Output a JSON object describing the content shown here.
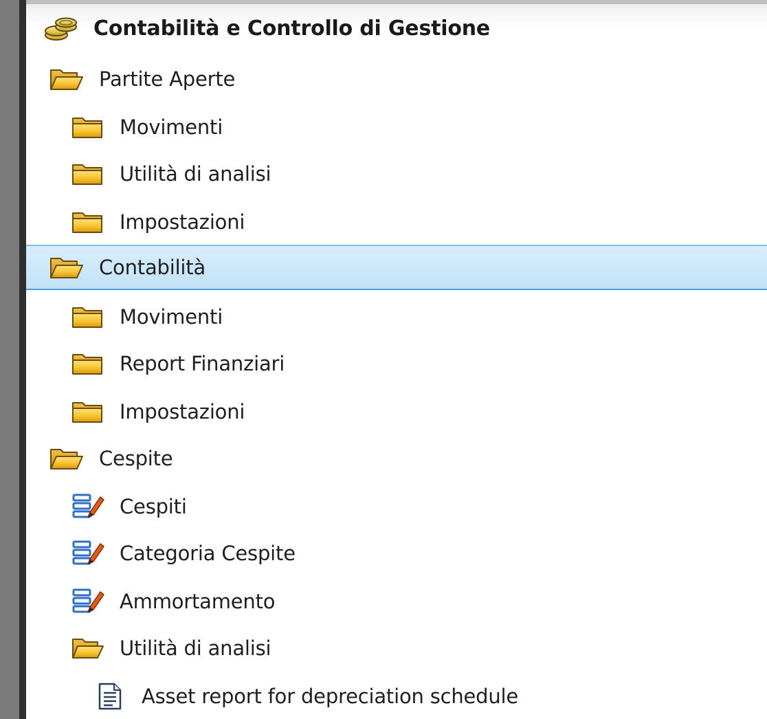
{
  "tree": {
    "root": {
      "label": "Contabilità e Controllo di Gestione",
      "icon": "coins-icon"
    },
    "items": [
      {
        "label": "Partite Aperte",
        "icon": "folder-open-icon",
        "level": 1
      },
      {
        "label": "Movimenti",
        "icon": "folder-icon",
        "level": 2
      },
      {
        "label": "Utilità di analisi",
        "icon": "folder-icon",
        "level": 2
      },
      {
        "label": "Impostazioni",
        "icon": "folder-icon",
        "level": 2
      },
      {
        "label": "Contabilità",
        "icon": "folder-open-icon",
        "level": 1,
        "selected": true
      },
      {
        "label": "Movimenti",
        "icon": "folder-icon",
        "level": 2
      },
      {
        "label": "Report Finanziari",
        "icon": "folder-icon",
        "level": 2
      },
      {
        "label": "Impostazioni",
        "icon": "folder-icon",
        "level": 2
      },
      {
        "label": "Cespite",
        "icon": "folder-open-icon",
        "level": 1
      },
      {
        "label": "Cespiti",
        "icon": "edit-list-icon",
        "level": 2
      },
      {
        "label": "Categoria Cespite",
        "icon": "edit-list-icon",
        "level": 2
      },
      {
        "label": "Ammortamento",
        "icon": "edit-list-icon",
        "level": 2
      },
      {
        "label": "Utilità di analisi",
        "icon": "folder-open-icon",
        "level": 2
      },
      {
        "label": "Asset report for depreciation schedule",
        "icon": "report-document-icon",
        "level": 3
      }
    ]
  },
  "colors": {
    "selection_background": "#c2e2f7",
    "selection_border": "#4aa3df",
    "folder_yellow": "#f5c030",
    "folder_outline": "#6b4a0a",
    "edit_list_blue": "#2f6fc7",
    "edit_pencil_orange": "#e05a1a"
  }
}
